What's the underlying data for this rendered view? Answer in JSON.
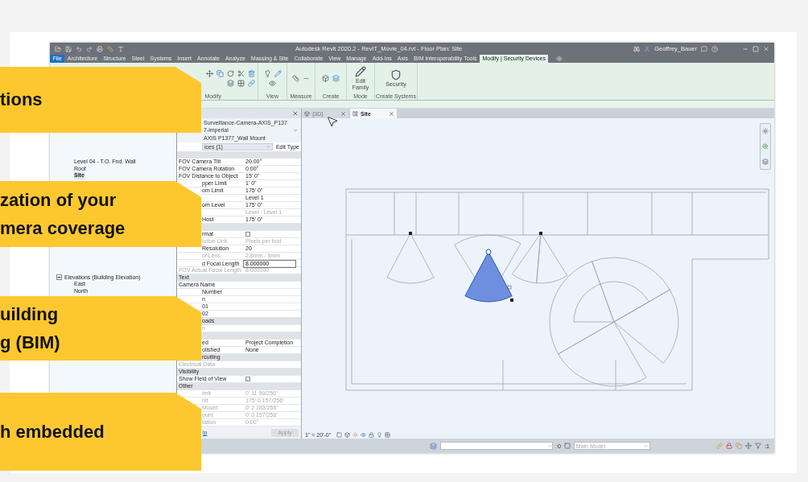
{
  "window": {
    "title": "Autodesk Revit 2020.2 - RevIT_Movie_04.rvt - Floor Plan: Site",
    "user": "Geoffrey_Bauer"
  },
  "ribbon": {
    "tabs": [
      {
        "label": "File",
        "kind": "file",
        "selected": false
      },
      {
        "label": "Architecture",
        "kind": "tab",
        "selected": false
      },
      {
        "label": "Structure",
        "kind": "tab",
        "selected": false
      },
      {
        "label": "Steel",
        "kind": "tab",
        "selected": false
      },
      {
        "label": "Systems",
        "kind": "tab",
        "selected": false
      },
      {
        "label": "Insert",
        "kind": "tab",
        "selected": false
      },
      {
        "label": "Annotate",
        "kind": "tab",
        "selected": false
      },
      {
        "label": "Analyze",
        "kind": "tab",
        "selected": false
      },
      {
        "label": "Massing & Site",
        "kind": "tab",
        "selected": false
      },
      {
        "label": "Collaborate",
        "kind": "tab",
        "selected": false
      },
      {
        "label": "View",
        "kind": "tab",
        "selected": false
      },
      {
        "label": "Manage",
        "kind": "tab",
        "selected": false
      },
      {
        "label": "Add-Ins",
        "kind": "tab",
        "selected": false
      },
      {
        "label": "Axis",
        "kind": "tab",
        "selected": false
      },
      {
        "label": "BIM Interoperability Tools",
        "kind": "tab",
        "selected": false
      },
      {
        "label": "Modify | Security Devices",
        "kind": "tab",
        "selected": true
      }
    ],
    "panels": [
      {
        "label": "Modify",
        "kind": "tools"
      },
      {
        "label": "View",
        "kind": "tools"
      },
      {
        "label": "Measure",
        "kind": "tools"
      },
      {
        "label": "Create",
        "kind": "tools"
      },
      {
        "label": "Mode",
        "kind": "button",
        "button": "Edit Family"
      },
      {
        "label": "Create Systems",
        "kind": "button",
        "button": "Security"
      }
    ]
  },
  "project_browser": {
    "items": [
      {
        "label": "Level 04 - T.O. Fnd. Wall",
        "kind": "leaf",
        "selected": false
      },
      {
        "label": "Roof",
        "kind": "leaf",
        "selected": false
      },
      {
        "label": "Site",
        "kind": "leaf",
        "selected": true
      },
      {
        "label": "Elevations (Building Elevation)",
        "kind": "group",
        "selected": false,
        "expanded": true,
        "children": [
          {
            "label": "East",
            "selected": false
          },
          {
            "label": "North",
            "selected": false
          }
        ]
      }
    ]
  },
  "properties": {
    "type_name": "Surveillance-Camera-AXIS_P1377-imperial",
    "type_subname": "AXIS P1377_Wall Mount",
    "instance_filter": "ices (1)",
    "edit_type": "Edit Type",
    "help": "lp",
    "apply": "Apply",
    "rows": [
      {
        "kind": "section"
      },
      {
        "kind": "param",
        "label": "FOV Camera Tilt",
        "value": "20.00°",
        "covered": false,
        "disabled": false
      },
      {
        "kind": "param",
        "label": "FOV Camera Rotation",
        "value": "0.00°",
        "covered": false,
        "disabled": false
      },
      {
        "kind": "param",
        "label": "FOV Distance to Object",
        "value": "15'  0\"",
        "covered": false,
        "disabled": false
      },
      {
        "kind": "param",
        "label": "pper Limit",
        "value": "1'  0\"",
        "covered": true,
        "disabled": false
      },
      {
        "kind": "param",
        "label": "om Limit",
        "value": "175'  0\"",
        "covered": true,
        "disabled": false
      },
      {
        "kind": "param",
        "value": "Level 1",
        "disabled": false
      },
      {
        "kind": "param",
        "label": "om Level",
        "value": "175'  0\"",
        "covered": true,
        "disabled": false
      },
      {
        "kind": "param",
        "value": "Level : Level 1",
        "disabled": true
      },
      {
        "kind": "param",
        "label": "Host",
        "value": "175'  0\"",
        "covered": true,
        "disabled": false
      },
      {
        "kind": "section"
      },
      {
        "kind": "check",
        "label": "rmat",
        "checked": false,
        "covered": true,
        "disabled": false
      },
      {
        "kind": "param",
        "label": "lution Unit",
        "value": "Pixels per foot",
        "covered": true,
        "disabled": true
      },
      {
        "kind": "param",
        "label": "Resolution",
        "value": "20",
        "covered": true,
        "disabled": false
      },
      {
        "kind": "param",
        "label": "of Lens",
        "value": "2.8mm - 8mm",
        "covered": true,
        "disabled": true
      },
      {
        "kind": "input",
        "label": "d Focal Length",
        "value": "8.000000",
        "covered": true,
        "disabled": false
      },
      {
        "kind": "param",
        "label": "FOV Actual Focal Length",
        "value": "8.000000",
        "covered": false,
        "disabled": true
      },
      {
        "kind": "section",
        "label": "Text",
        "covered": false
      },
      {
        "kind": "param",
        "label": "Camera Name",
        "covered": false,
        "disabled": false
      },
      {
        "kind": "param",
        "label": "Number",
        "covered": true,
        "disabled": false
      },
      {
        "kind": "param",
        "label": "n",
        "covered": true,
        "disabled": false
      },
      {
        "kind": "param",
        "label": "01",
        "covered": true,
        "disabled": false
      },
      {
        "kind": "param",
        "label": "02",
        "covered": true,
        "disabled": false
      },
      {
        "kind": "section",
        "label": "oads",
        "covered": true
      },
      {
        "kind": "param",
        "label": "n",
        "covered": true,
        "disabled": true
      },
      {
        "kind": "section"
      },
      {
        "kind": "param",
        "label": "ed",
        "value": "Project Completion",
        "covered": true,
        "disabled": false
      },
      {
        "kind": "param",
        "label": "olished",
        "value": "None",
        "covered": true,
        "disabled": false
      },
      {
        "kind": "section",
        "label": "rcuiting",
        "covered": true
      },
      {
        "kind": "param",
        "label": "Electrical Data",
        "covered": false,
        "disabled": true
      },
      {
        "kind": "section",
        "label": "Visibility",
        "covered": false
      },
      {
        "kind": "check",
        "label": "Show Field of View",
        "checked": true,
        "covered": false,
        "disabled": false
      },
      {
        "kind": "section",
        "label": "Other",
        "covered": false
      },
      {
        "kind": "param",
        "label": "imit",
        "value": "0'  11 99/256\"",
        "covered": true,
        "disabled": true
      },
      {
        "kind": "param",
        "label": "nit",
        "value": "175'  0 157/256\"",
        "covered": true,
        "disabled": true
      },
      {
        "kind": "param",
        "label": "Mount",
        "value": "0'  2 183/256\"",
        "covered": true,
        "disabled": true
      },
      {
        "kind": "param",
        "label": "ount",
        "value": "0'  0 157/256\"",
        "covered": true,
        "disabled": true
      },
      {
        "kind": "param",
        "label": "tation",
        "value": "0.00°",
        "covered": true,
        "disabled": true
      }
    ]
  },
  "view": {
    "tabs": [
      {
        "label": "{3D}",
        "kind": "model",
        "selected": false
      },
      {
        "label": "Site",
        "kind": "plan",
        "selected": true
      }
    ],
    "scale": "1\" = 20'-0\""
  },
  "status_bar": {
    "model": "Main Model",
    "count_left": ":0",
    "count_right": ":1"
  },
  "callouts": [
    {
      "lines": [
        "tions"
      ]
    },
    {
      "lines": [
        "zation of your",
        "mera coverage"
      ]
    },
    {
      "lines": [
        "uilding",
        "g (BIM)"
      ]
    },
    {
      "lines": [
        "h embedded"
      ]
    }
  ]
}
